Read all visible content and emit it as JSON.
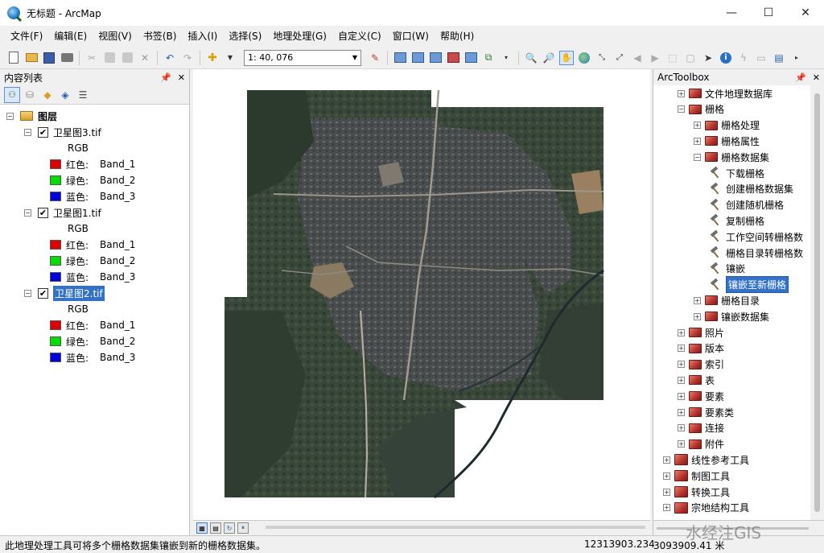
{
  "window": {
    "title": "无标题 - ArcMap",
    "controls": {
      "minimize": "—",
      "maximize": "☐",
      "close": "✕"
    }
  },
  "menu": [
    "文件(F)",
    "编辑(E)",
    "视图(V)",
    "书签(B)",
    "插入(I)",
    "选择(S)",
    "地理处理(G)",
    "自定义(C)",
    "窗口(W)",
    "帮助(H)"
  ],
  "toolbar": {
    "scale": "1: 40, 076"
  },
  "toc": {
    "title": "内容列表",
    "root_label": "图层",
    "layers": [
      {
        "name": "卫星图3.tif",
        "checked": true,
        "selected": false,
        "render": "RGB",
        "bands": [
          {
            "channel": "红色:",
            "band": "Band_1",
            "color": "#e00000"
          },
          {
            "channel": "绿色:",
            "band": "Band_2",
            "color": "#00e000"
          },
          {
            "channel": "蓝色:",
            "band": "Band_3",
            "color": "#0000e0"
          }
        ]
      },
      {
        "name": "卫星图1.tif",
        "checked": true,
        "selected": false,
        "render": "RGB",
        "bands": [
          {
            "channel": "红色:",
            "band": "Band_1",
            "color": "#e00000"
          },
          {
            "channel": "绿色:",
            "band": "Band_2",
            "color": "#00e000"
          },
          {
            "channel": "蓝色:",
            "band": "Band_3",
            "color": "#0000e0"
          }
        ]
      },
      {
        "name": "卫星图2.tif",
        "checked": true,
        "selected": true,
        "render": "RGB",
        "bands": [
          {
            "channel": "红色:",
            "band": "Band_1",
            "color": "#e00000"
          },
          {
            "channel": "绿色:",
            "band": "Band_2",
            "color": "#00e000"
          },
          {
            "channel": "蓝色:",
            "band": "Band_3",
            "color": "#0000e0"
          }
        ]
      }
    ]
  },
  "toolbox": {
    "title": "ArcToolbox",
    "items": [
      {
        "label": "文件地理数据库",
        "indent": 1,
        "type": "toolset",
        "expander": "+"
      },
      {
        "label": "栅格",
        "indent": 1,
        "type": "toolset",
        "expander": "-"
      },
      {
        "label": "栅格处理",
        "indent": 2,
        "type": "toolset",
        "expander": "+"
      },
      {
        "label": "栅格属性",
        "indent": 2,
        "type": "toolset",
        "expander": "+"
      },
      {
        "label": "栅格数据集",
        "indent": 2,
        "type": "toolset",
        "expander": "-"
      },
      {
        "label": "下载栅格",
        "indent": 3,
        "type": "tool"
      },
      {
        "label": "创建栅格数据集",
        "indent": 3,
        "type": "tool"
      },
      {
        "label": "创建随机栅格",
        "indent": 3,
        "type": "tool"
      },
      {
        "label": "复制栅格",
        "indent": 3,
        "type": "tool"
      },
      {
        "label": "工作空间转栅格数",
        "indent": 3,
        "type": "tool"
      },
      {
        "label": "栅格目录转栅格数",
        "indent": 3,
        "type": "tool"
      },
      {
        "label": "镶嵌",
        "indent": 3,
        "type": "tool"
      },
      {
        "label": "镶嵌至新栅格",
        "indent": 3,
        "type": "tool",
        "selected": true
      },
      {
        "label": "栅格目录",
        "indent": 2,
        "type": "toolset",
        "expander": "+"
      },
      {
        "label": "镶嵌数据集",
        "indent": 2,
        "type": "toolset",
        "expander": "+"
      },
      {
        "label": "照片",
        "indent": 1,
        "type": "toolset",
        "expander": "+"
      },
      {
        "label": "版本",
        "indent": 1,
        "type": "toolset",
        "expander": "+"
      },
      {
        "label": "索引",
        "indent": 1,
        "type": "toolset",
        "expander": "+"
      },
      {
        "label": "表",
        "indent": 1,
        "type": "toolset",
        "expander": "+"
      },
      {
        "label": "要素",
        "indent": 1,
        "type": "toolset",
        "expander": "+"
      },
      {
        "label": "要素类",
        "indent": 1,
        "type": "toolset",
        "expander": "+"
      },
      {
        "label": "连接",
        "indent": 1,
        "type": "toolset",
        "expander": "+"
      },
      {
        "label": "附件",
        "indent": 1,
        "type": "toolset",
        "expander": "+"
      },
      {
        "label": "线性参考工具",
        "indent": 0,
        "type": "toolbox",
        "expander": "+"
      },
      {
        "label": "制图工具",
        "indent": 0,
        "type": "toolbox",
        "expander": "+"
      },
      {
        "label": "转换工具",
        "indent": 0,
        "type": "toolbox",
        "expander": "+"
      },
      {
        "label": "宗地结构工具",
        "indent": 0,
        "type": "toolbox",
        "expander": "+"
      }
    ]
  },
  "status": {
    "message": "此地理处理工具可将多个栅格数据集镶嵌到新的栅格数据集。",
    "x": "12313903.234",
    "y": "3093909.41 米"
  },
  "watermark": "水经注GIS",
  "colors": {
    "selection": "#3472c8",
    "toolbox_red": "#b3322b"
  }
}
